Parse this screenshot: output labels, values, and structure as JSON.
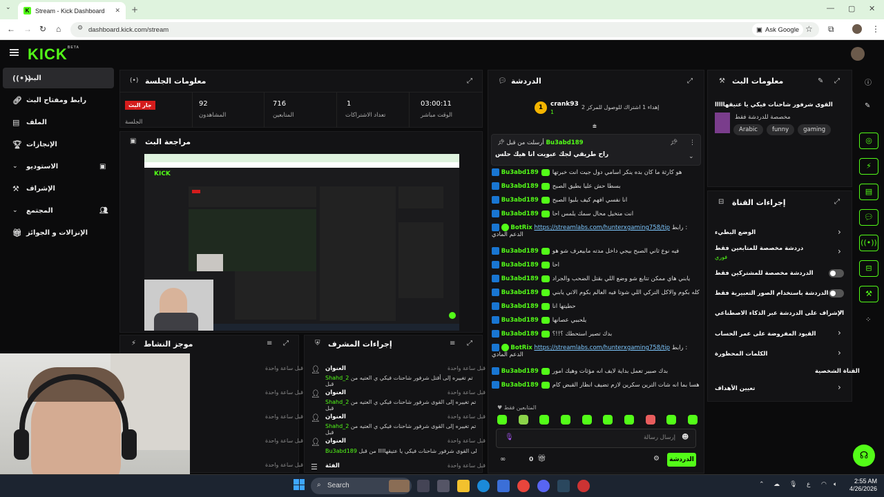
{
  "browser": {
    "tab_title": "Stream - Kick Dashboard",
    "url": "dashboard.kick.com/stream",
    "ask_google": "Ask Google"
  },
  "kick": {
    "logo": "KICK",
    "beta": "BETA"
  },
  "sidebar": {
    "items": [
      {
        "label": "البث",
        "icon": "radio"
      },
      {
        "label": "رابط ومفتاح البث",
        "icon": "link"
      },
      {
        "label": "الملف",
        "icon": "file"
      },
      {
        "label": "الإنجازات",
        "icon": "trophy"
      },
      {
        "label": "الاستوديو",
        "icon": "monitor"
      },
      {
        "label": "الإشراف",
        "icon": "hammer"
      },
      {
        "label": "المجتمع",
        "icon": "users"
      },
      {
        "label": "الإنزالات و الجوائز",
        "icon": "gift"
      }
    ]
  },
  "session": {
    "title": "معلومات الجلسة",
    "live_badge": "جار البث",
    "live_label": "الجلسة",
    "stats": [
      {
        "value": "92",
        "label": "المشاهدون"
      },
      {
        "value": "716",
        "label": "المتابعين"
      },
      {
        "value": "1",
        "label": "تعداد الاشتراكات"
      },
      {
        "value": "03:00:11",
        "label": "الوقت مباشر"
      }
    ]
  },
  "preview": {
    "title": "مراجعة البث"
  },
  "activity": {
    "title": "موجز النشاط",
    "rows": [
      "قبل ساعة واحدة",
      "قبل ساعة واحدة",
      "قبل ساعة واحدة",
      "قبل ساعة واحدة",
      "قبل ساعة واحدة",
      "قبل ساعة واحدة"
    ]
  },
  "mod": {
    "title": "إجراءات المشرف",
    "rows": [
      {
        "head": "العنوان",
        "time": "قبل ساعة واحدة",
        "user": "Shahd_2",
        "text": "تم تغييره إلى أقتل شرفور شاحنات فيكي ي العتيه من قبل"
      },
      {
        "head": "العنوان",
        "time": "قبل ساعة واحدة",
        "user": "Shahd_2",
        "text": "تم تغييره إلى القوى شرفور شاحنات فيكي ي العتيه من قبل"
      },
      {
        "head": "العنوان",
        "time": "قبل ساعة واحدة",
        "user": "Shahd_2",
        "text": "تم تغييره إلى القوى شرفور شاحنات فيكي ي العتيه من قبل"
      },
      {
        "head": "العنوان",
        "time": "قبل ساعة واحدة",
        "user": "Bu3abd189",
        "text": "تم تغييره إلى القوى شرفور شاحنات فيكي يا عتيقهااااا من قبل"
      },
      {
        "head": "الفئة",
        "time": "قبل ساعة واحدة",
        "user": "",
        "text": ""
      }
    ]
  },
  "chat": {
    "title": "الدردشة",
    "top_user": "crank93",
    "top_count": "1",
    "goal_text": "إهداء 1 اشتراك للوصول للمركز 2",
    "pinned_by": "أرسلت من قبل",
    "pinned_user": "Bu3abd189",
    "pinned_text": "راح طريقي لجك عبويت انا هيك حلس",
    "messages": [
      {
        "user": "Bu3abd189",
        "text": "هو كارثة ما كان بده ينكر اسامي دول جيت انت خبرتها"
      },
      {
        "user": "Bu3abd189",
        "text": "بسطا حش عليا بطيق الصبح"
      },
      {
        "user": "Bu3abd189",
        "text": "انا نفسي افهم كيف بلبوا الصبح"
      },
      {
        "user": "Bu3abd189",
        "text": "انت متخيل محال سمك يلمس احا"
      },
      {
        "user": "BotRix",
        "text": "رابط :",
        "link": "https://streamlabs.com/hunterxgaming758/tip",
        "tail": "الدعم المادي"
      },
      {
        "user": "Bu3abd189",
        "text": "فيه نوع ثاني الصبح بيجي داخل مدته مابيعرف شو هو"
      },
      {
        "user": "Bu3abd189",
        "text": "احا"
      },
      {
        "user": "Bu3abd189",
        "text": "يابني هاي ممكن تتابع شو وضع اللي بقتل الضحب والجراد"
      },
      {
        "user": "Bu3abd189",
        "text": "كله بكوم والاكل التركي اللي شوتا فيه العالم بكوم الاني يابني"
      },
      {
        "user": "Bu3abd189",
        "text": "حطيتها انا"
      },
      {
        "user": "Bu3abd189",
        "text": "يلحببي عصانها"
      },
      {
        "user": "Bu3abd189",
        "text": "بدك تصير استحطك ؟!!؟"
      },
      {
        "user": "BotRix",
        "text": "رابط :",
        "link": "https://streamlabs.com/hunterxgaming758/tip",
        "tail": "الدعم المادي"
      },
      {
        "user": "Bu3abd189",
        "text": "بدك صبير تعمل بداية لايف انه مؤثات وهيك امور"
      },
      {
        "user": "Bu3abd189",
        "text": "هسا بما انه شات الترين سكرين لازم تضيف انظار القبض كام"
      }
    ],
    "followers_only": "المتابعين فقط",
    "input_placeholder": "إرسال رسالة",
    "points": "0",
    "send_button": "الدردشة"
  },
  "stream_info": {
    "title": "معلومات البث",
    "stream_title": "القوى شرفور شاحنات فيكي يا عتيقهااااا",
    "category_line": "مخصصة للدردشة فقط",
    "tags": [
      "Arabic",
      "funny",
      "gaming"
    ]
  },
  "channel_actions": {
    "title": "إجراءات القناة",
    "rows": [
      {
        "label": "الوضع البطيء",
        "kind": "chevron"
      },
      {
        "label": "دردشة مخصصة للمتابعين فقط",
        "sub": "فوري",
        "kind": "chevron"
      },
      {
        "label": "الدردشة مخصصة للمشتركين فقط",
        "kind": "toggle"
      },
      {
        "label": "الدردشة باستخدام الصور التعبيرية فقط",
        "kind": "toggle"
      },
      {
        "label": "الإشراف على الدردشة عبر الذكاء الاصطناعي",
        "kind": "external"
      },
      {
        "label": "القيود المفروضة على عمر الحساب",
        "kind": "chevron"
      },
      {
        "label": "الكلمات المحظورة",
        "kind": "chevron"
      },
      {
        "label": "القناة الشخصية",
        "kind": "none"
      },
      {
        "label": "تعيين الأهداف",
        "kind": "chevron"
      }
    ]
  },
  "taskbar": {
    "search": "Search",
    "time": "2:55 AM",
    "date": "4/26/2026",
    "lang": "ع"
  },
  "colors": {
    "accent": "#53fc18",
    "live": "#d41c1c",
    "bg": "#0b0b0c",
    "panel": "#131315"
  }
}
